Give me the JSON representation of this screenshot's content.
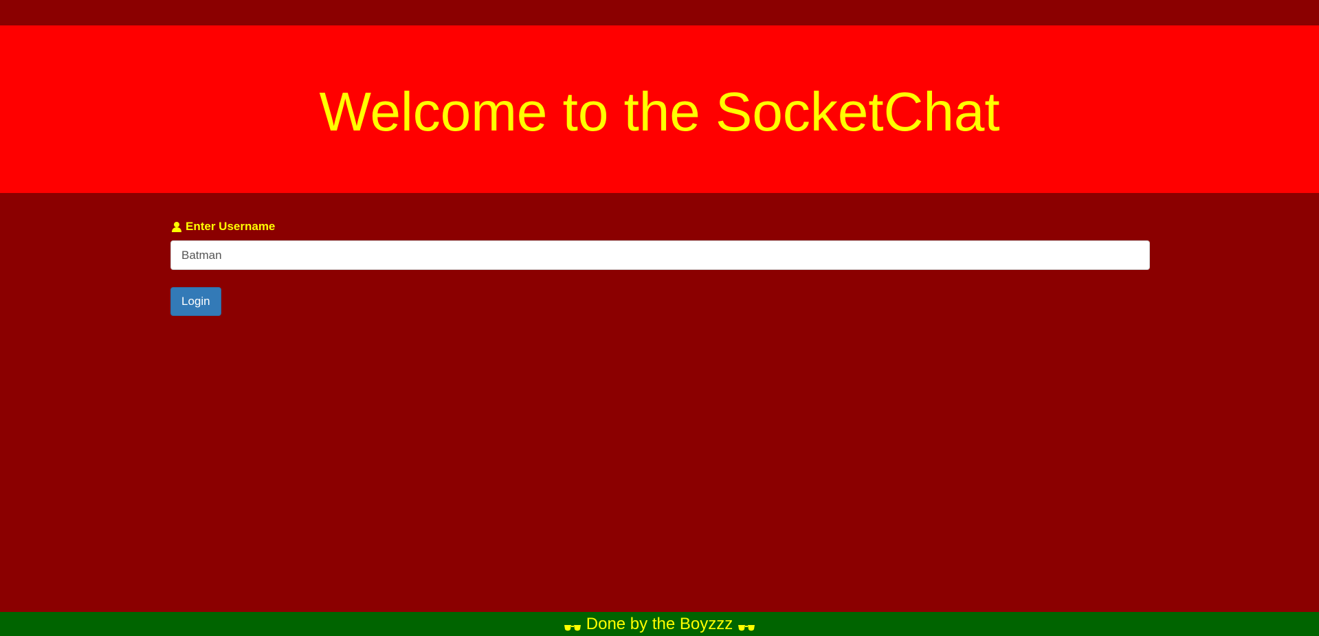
{
  "colors": {
    "page_background": "#8b0000",
    "hero_background": "#ff0000",
    "accent_text": "#ffff00",
    "footer_background": "#006400",
    "button_background": "#337ab7"
  },
  "header": {
    "title": "Welcome to the SocketChat"
  },
  "login_form": {
    "label_icon": "user-icon",
    "label": "Enter Username",
    "username_value": "Batman",
    "login_button_label": "Login"
  },
  "footer": {
    "icon": "sunglasses-icon",
    "text": "Done by the Boyzzz"
  }
}
